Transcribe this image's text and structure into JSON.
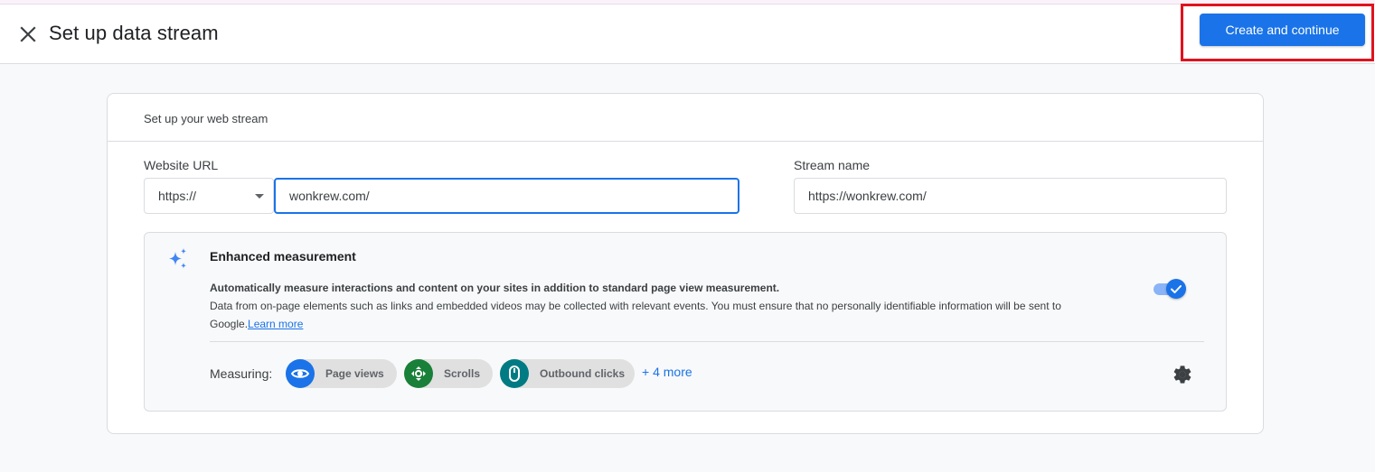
{
  "header": {
    "title": "Set up data stream",
    "close_icon": "close-icon",
    "primary_button": "Create and continue"
  },
  "colors": {
    "accent": "#1a73e8",
    "highlight": "#e0121e",
    "chip_page_views": "#1a73e8",
    "chip_scrolls": "#188038",
    "chip_outbound": "#007b83"
  },
  "card": {
    "title": "Set up your web stream",
    "website_url": {
      "label": "Website URL",
      "protocol_selected": "https://",
      "value": "wonkrew.com/"
    },
    "stream_name": {
      "label": "Stream name",
      "value": "https://wonkrew.com/"
    },
    "enhanced_measurement": {
      "icon": "sparkle-icon",
      "title": "Enhanced measurement",
      "description_bold": "Automatically measure interactions and content on your sites in addition to standard page view measurement.",
      "description": "Data from on-page elements such as links and embedded videos may be collected with relevant events. You must ensure that no personally identifiable information will be sent to Google.",
      "learn_more": "Learn more",
      "toggle_on": true,
      "measuring_label": "Measuring:",
      "chips": [
        {
          "label": "Page views",
          "icon": "eye-icon"
        },
        {
          "label": "Scrolls",
          "icon": "scroll-arrows-icon"
        },
        {
          "label": "Outbound clicks",
          "icon": "mouse-icon"
        }
      ],
      "more_link": "+ 4 more",
      "settings_icon": "gear-icon"
    }
  }
}
